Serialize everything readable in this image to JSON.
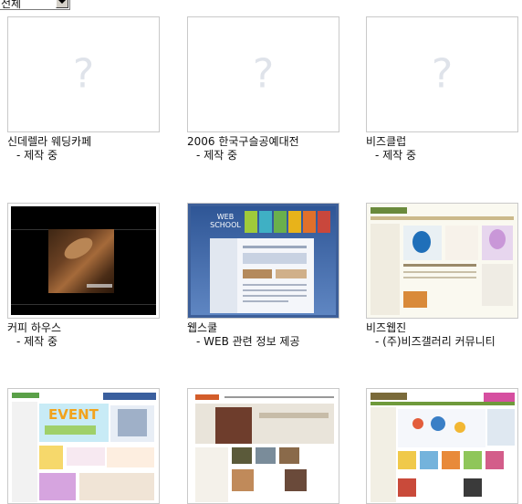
{
  "filter": {
    "selected": "전체"
  },
  "portfolio": [
    {
      "title": "신데렐라 웨딩카페",
      "desc": "- 제작 중",
      "thumb": "placeholder"
    },
    {
      "title": "2006 한국구슬공예대전",
      "desc": "- 제작 중",
      "thumb": "placeholder"
    },
    {
      "title": "비즈클럽",
      "desc": "- 제작 중",
      "thumb": "placeholder"
    },
    {
      "title": "커피 하우스",
      "desc": "- 제작 중",
      "thumb": "coffee"
    },
    {
      "title": "웹스쿨",
      "desc": "- WEB 관련 정보 제공",
      "thumb": "webschool",
      "thumb_text": "WEB SCHOOL"
    },
    {
      "title": "비즈웹진",
      "desc": "- (주)비즈갤러리 커뮤니티",
      "thumb": "beadsgallery"
    },
    {
      "title": "",
      "desc": "",
      "thumb": "event",
      "thumb_text": "EVENT"
    },
    {
      "title": "",
      "desc": "",
      "thumb": "church"
    },
    {
      "title": "",
      "desc": "",
      "thumb": "shop"
    }
  ],
  "placeholder_glyph": "?",
  "colors": {
    "border": "#c9c9c9",
    "placeholder": "#dfe3ea"
  }
}
